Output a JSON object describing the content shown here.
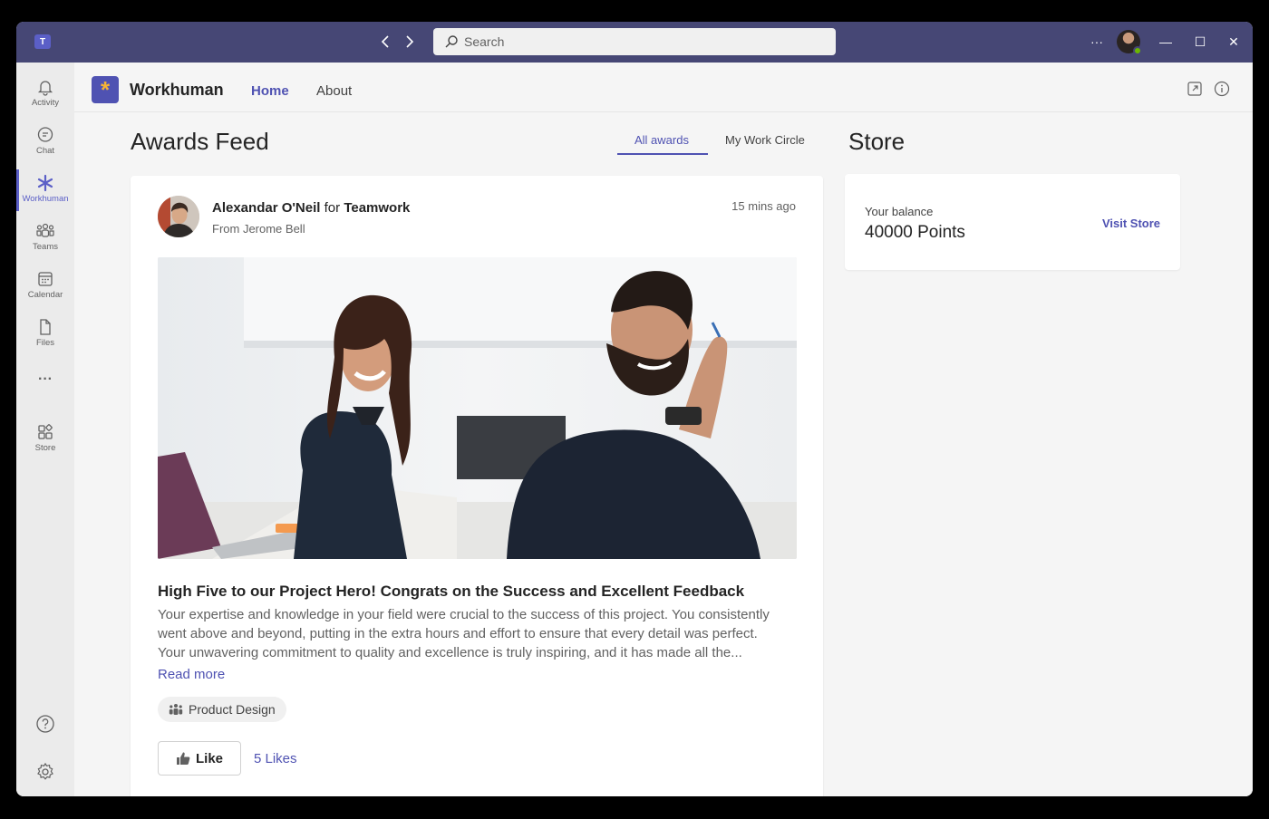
{
  "titlebar": {
    "logo_letter": "T",
    "back_icon": "chevron-left-icon",
    "forward_icon": "chevron-right-icon",
    "search_placeholder": "Search",
    "more_label": "···",
    "minimize_label": "—",
    "maximize_label": "☐",
    "close_label": "✕"
  },
  "rail": {
    "items": [
      {
        "label": "Activity",
        "icon": "bell-icon"
      },
      {
        "label": "Chat",
        "icon": "chat-icon"
      },
      {
        "label": "Workhuman",
        "icon": "asterisk-icon",
        "active": true
      },
      {
        "label": "Teams",
        "icon": "teams-icon"
      },
      {
        "label": "Calendar",
        "icon": "calendar-icon"
      },
      {
        "label": "Files",
        "icon": "file-icon"
      },
      {
        "label": "···",
        "icon": "more-icon"
      },
      {
        "label": "Store",
        "icon": "store-icon"
      }
    ],
    "help_icon": "help-icon",
    "settings_icon": "settings-icon"
  },
  "app_header": {
    "logo_glyph": "*",
    "app_name": "Workhuman",
    "tabs": [
      {
        "label": "Home",
        "active": true
      },
      {
        "label": "About",
        "active": false
      }
    ]
  },
  "feed": {
    "title": "Awards Feed",
    "filters": [
      {
        "label": "All awards",
        "active": true
      },
      {
        "label": "My Work Circle",
        "active": false
      }
    ]
  },
  "post": {
    "recipient": "Alexandar O'Neil",
    "connector": "for",
    "award": "Teamwork",
    "from": "From Jerome Bell",
    "time": "15 mins ago",
    "title": "High Five to our Project Hero! Congrats on the Success and Excellent Feedback",
    "body_line1": "Your expertise and knowledge in your field were crucial to the success of this project. You consistently",
    "body_line2": "went above and beyond, putting in the extra hours and effort to ensure that every detail was perfect.",
    "body_line3": "Your unwavering commitment to quality and excellence is truly inspiring, and it has made all the...",
    "read_more": "Read more",
    "tag": "Product Design",
    "like_label": "Like",
    "likes_count": "5 Likes"
  },
  "store": {
    "title": "Store",
    "balance_label": "Your balance",
    "balance_value": "40000 Points",
    "visit_label": "Visit Store"
  },
  "colors": {
    "titlebar": "#464775",
    "accent": "#4f52b2",
    "logo_star": "#f5b335",
    "presence": "#6bb700"
  }
}
